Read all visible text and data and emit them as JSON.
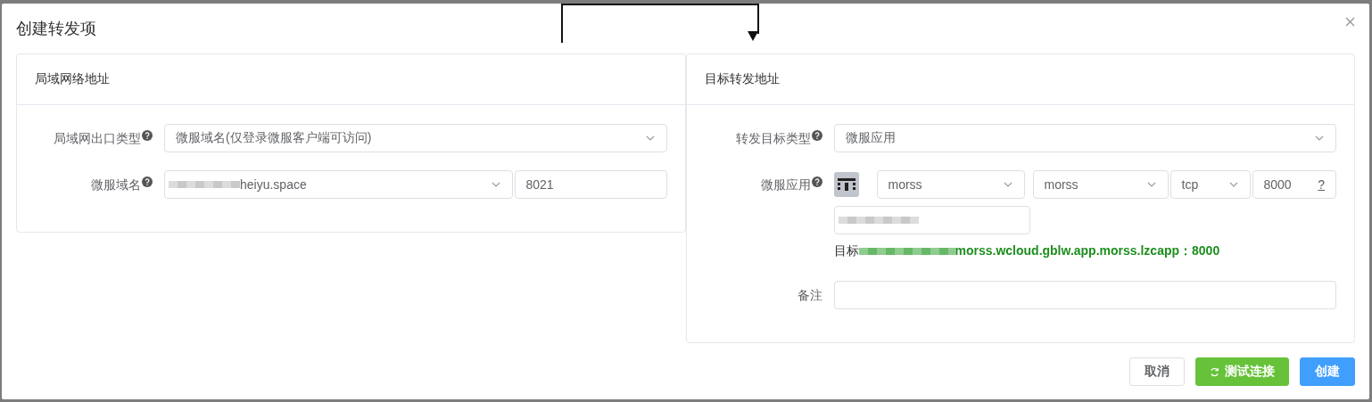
{
  "dialog": {
    "title": "创建转发项"
  },
  "lan": {
    "title": "局域网络地址",
    "fields": [
      {
        "kind": "select",
        "label": "局域网出口类型",
        "help": true,
        "value": "微服域名(仅登录微服客户端可访问)"
      },
      {
        "kind": "domain",
        "label": "微服域名",
        "help": true,
        "value": "heiyu.space",
        "port": "8021"
      }
    ]
  },
  "target": {
    "title": "目标转发地址",
    "fields": [
      {
        "kind": "select",
        "label": "转发目标类型",
        "help": true,
        "value": "微服应用"
      },
      {
        "kind": "app",
        "label": "微服应用",
        "help": true,
        "selects": [
          "morss",
          "morss",
          "tcp"
        ],
        "port": "8000",
        "port_hint": "?",
        "summary_label": "目标",
        "summary_value": "morss.wcloud.gblw.app.morss.lzcapp：8000"
      },
      {
        "kind": "text",
        "label": "备注",
        "help": false
      }
    ]
  },
  "buttons": [
    {
      "label": "取消",
      "kind": "default"
    },
    {
      "label": "测试连接",
      "kind": "success"
    },
    {
      "label": "创建",
      "kind": "primary"
    }
  ]
}
